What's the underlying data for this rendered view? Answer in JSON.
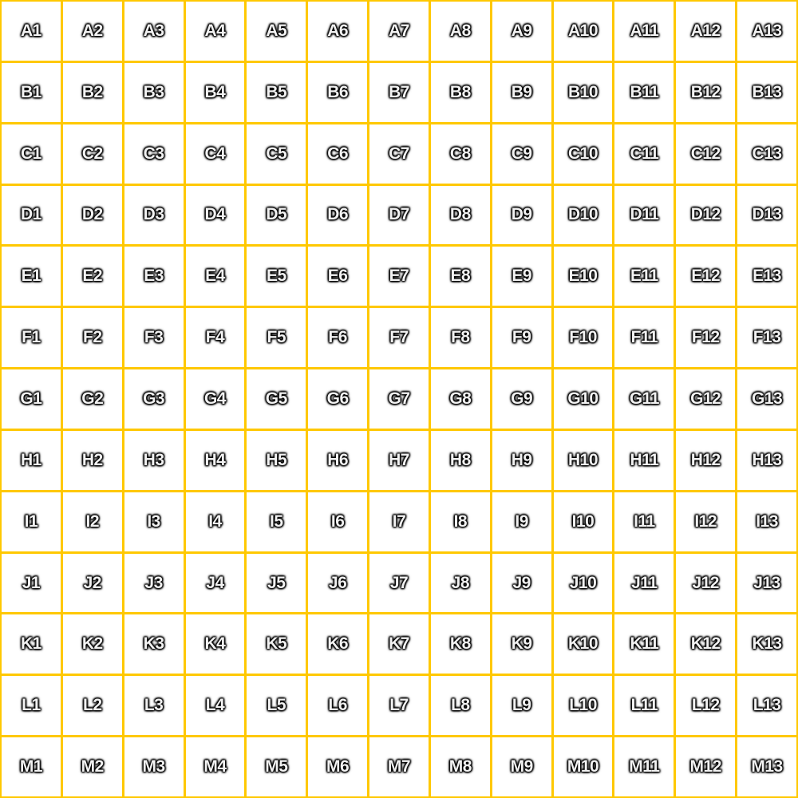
{
  "colors": {
    "grid_line": "#FFC800",
    "cell_bg": "#FFFFFF"
  },
  "grid": {
    "rows": [
      "A",
      "B",
      "C",
      "D",
      "E",
      "F",
      "G",
      "H",
      "I",
      "J",
      "K",
      "L",
      "M"
    ],
    "cells": [
      [
        "A1",
        "A2",
        "A3",
        "A4",
        "A5",
        "A6",
        "A7",
        "A8",
        "A9",
        "A10",
        "A11",
        "A12",
        "A13"
      ],
      [
        "B1",
        "B2",
        "B3",
        "B4",
        "B5",
        "B6",
        "B7",
        "B8",
        "B9",
        "B10",
        "B11",
        "B12",
        "B13"
      ],
      [
        "C1",
        "C2",
        "C3",
        "C4",
        "C5",
        "C6",
        "C7",
        "C8",
        "C9",
        "C10",
        "C11",
        "C12",
        "C13"
      ],
      [
        "D1",
        "D2",
        "D3",
        "D4",
        "D5",
        "D6",
        "D7",
        "D8",
        "D9",
        "D10",
        "D11",
        "D12",
        "D13"
      ],
      [
        "E1",
        "E2",
        "E3",
        "E4",
        "E5",
        "E6",
        "E7",
        "E8",
        "E9",
        "E10",
        "E11",
        "E12",
        "E13"
      ],
      [
        "F1",
        "F2",
        "F3",
        "F4",
        "F5",
        "F6",
        "F7",
        "F8",
        "F9",
        "F10",
        "F11",
        "F12",
        "F13"
      ],
      [
        "G1",
        "G2",
        "G3",
        "G4",
        "G5",
        "G6",
        "G7",
        "G8",
        "G9",
        "G10",
        "G11",
        "G12",
        "G13"
      ],
      [
        "H1",
        "H2",
        "H3",
        "H4",
        "H5",
        "H6",
        "H7",
        "H8",
        "H9",
        "H10",
        "H11",
        "H12",
        "H13"
      ],
      [
        "I1",
        "I2",
        "I3",
        "I4",
        "I5",
        "I6",
        "I7",
        "I8",
        "I9",
        "I10",
        "I11",
        "I12",
        "I13"
      ],
      [
        "J1",
        "J2",
        "J3",
        "J4",
        "J5",
        "J6",
        "J7",
        "J8",
        "J9",
        "J10",
        "J11",
        "J12",
        "J13"
      ],
      [
        "K1",
        "K2",
        "K3",
        "K4",
        "K5",
        "K6",
        "K7",
        "K8",
        "K9",
        "K10",
        "K11",
        "K12",
        "K13"
      ],
      [
        "L1",
        "L2",
        "L3",
        "L4",
        "L5",
        "L6",
        "L7",
        "L8",
        "L9",
        "L10",
        "L11",
        "L12",
        "L13"
      ],
      [
        "M1",
        "M2",
        "M3",
        "M4",
        "M5",
        "M6",
        "M7",
        "M8",
        "M9",
        "M10",
        "M11",
        "M12",
        "M13"
      ]
    ]
  }
}
